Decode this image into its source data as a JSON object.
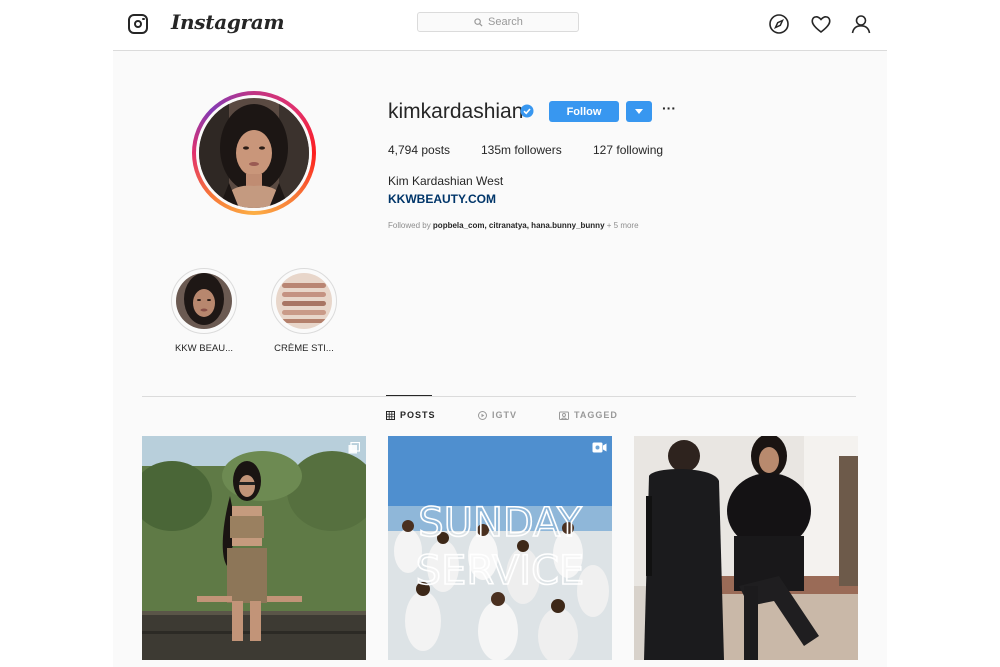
{
  "header": {
    "brand": "Instagram",
    "search_placeholder": "Search",
    "icons": [
      "compass-icon",
      "heart-icon",
      "profile-icon"
    ]
  },
  "profile": {
    "username": "kimkardashian",
    "verified": true,
    "follow_label": "Follow",
    "more_label": "···",
    "stats": {
      "posts": "4,794 posts",
      "followers": "135m followers",
      "following": "127 following"
    },
    "full_name": "Kim Kardashian West",
    "link": "KKWBEAUTY.COM",
    "followed_by": {
      "prefix": "Followed by",
      "names": "popbela_com, citranatya, hana.bunny_bunny",
      "more": "+ 5 more"
    }
  },
  "highlights": [
    {
      "label": "KKW BEAU..."
    },
    {
      "label": "CRÈME STI..."
    }
  ],
  "tabs": [
    {
      "label": "POSTS",
      "active": true
    },
    {
      "label": "IGTV",
      "active": false
    },
    {
      "label": "TAGGED",
      "active": false
    }
  ],
  "posts": [
    {
      "type": "multiple",
      "caption": ""
    },
    {
      "type": "video",
      "caption": "SUNDAY SERVICE"
    },
    {
      "type": "photo",
      "caption": ""
    }
  ],
  "colors": {
    "accent": "#3897f0",
    "link": "#003569",
    "border": "#dbdbdb",
    "background": "#fafafa"
  }
}
